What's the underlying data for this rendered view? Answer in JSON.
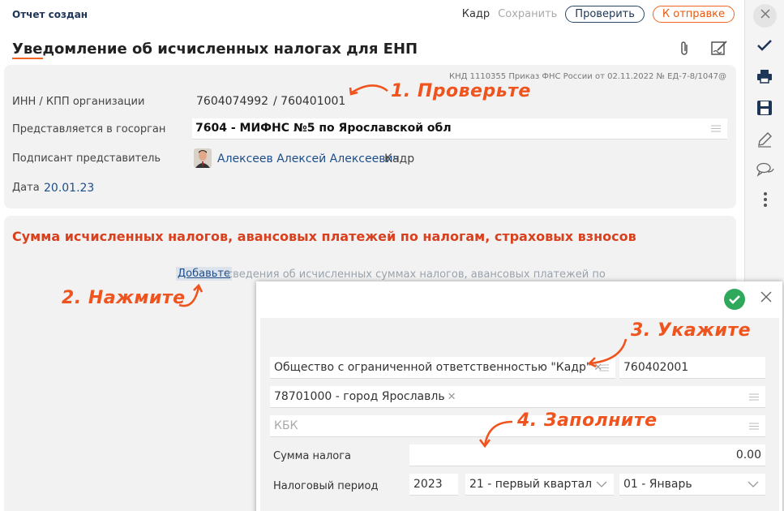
{
  "header": {
    "status": "Отчет создан",
    "kadr_link": "Кадр",
    "save_link": "Сохранить",
    "check_button": "Проверить",
    "send_button": "К отправке",
    "title": "Уведомление об исчисленных налогах для ЕНП"
  },
  "info": {
    "knd": "КНД 1110355 Приказ ФНС России от 02.11.2022 № ЕД-7-8/1047@",
    "inn_label": "ИНН / КПП организации",
    "inn_value": "7604074992",
    "kpp_value": "/ 760401001",
    "organ_label": "Представляется в госорган",
    "organ_value": "7604 - МИФНС №5 по Ярославской обл",
    "signer_label": "Подписант представитель",
    "signer_name": "Алексеев Алексей Алексеевич",
    "signer_role": "Кадр",
    "date_label": "Дата",
    "date_value": "20.01.23"
  },
  "section": {
    "title": "Сумма исчисленных налогов, авансовых платежей по налогам, страховых взносов",
    "add_link": "Добавьте",
    "add_rest": "сведения об исчисленных суммах налогов, авансовых платежей по"
  },
  "dialog": {
    "org_value": "Общество с ограниченной ответственностью \"Кадр\"",
    "kpp_value": "760402001",
    "oktmo_value": "78701000 - город Ярославль",
    "kbk_placeholder": "КБК",
    "sum_label": "Сумма налога",
    "sum_value": "0.00",
    "period_label": "Налоговый период",
    "year_value": "2023",
    "quarter_value": "21 - первый квартал",
    "month_value": "01 - Январь"
  },
  "annotations": {
    "step1": "1. Проверьте",
    "step2": "2. Нажмите",
    "step3": "3. Укажите",
    "step4": "4. Заполните"
  },
  "sidebar_icons": [
    "close-icon",
    "check-icon",
    "print-icon",
    "save-icon",
    "edit-icon",
    "chat-icon",
    "more-icon"
  ],
  "colors": {
    "accent": "#f26522",
    "link": "#1d4e89",
    "section_title": "#d8401e",
    "ok": "#2ea85a"
  }
}
